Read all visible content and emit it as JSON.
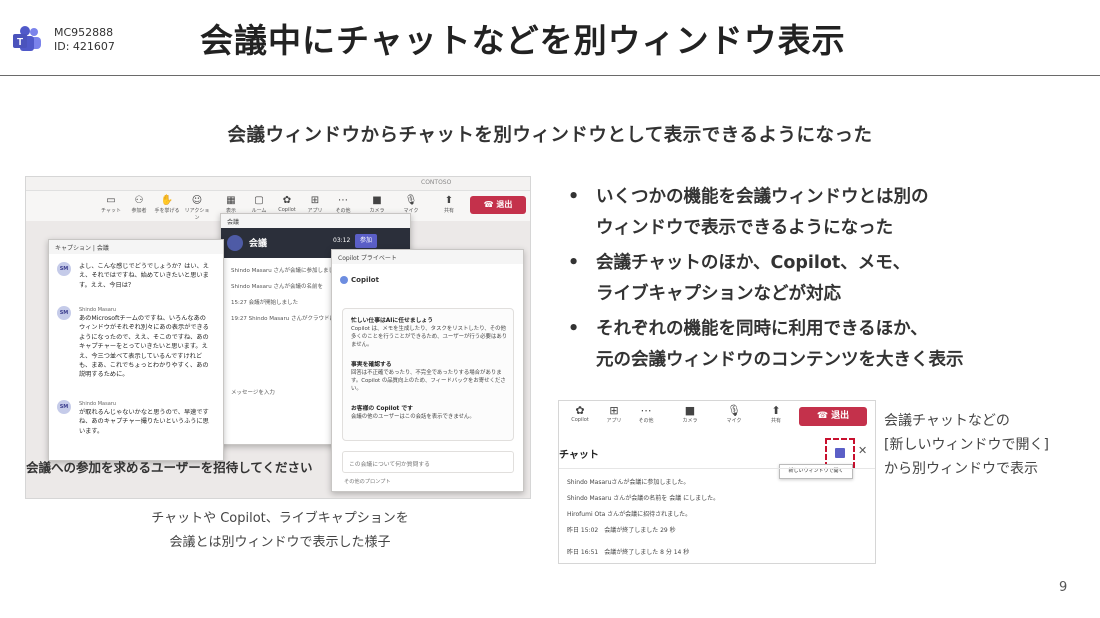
{
  "header": {
    "mc": "MC952888",
    "id": "ID: 421607",
    "title": "会議中にチャットなどを別ウィンドウ表示"
  },
  "subtitle": "会議ウィンドウからチャットを別ウィンドウとして表示できるようになった",
  "left_screenshot": {
    "org": "CONTOSO",
    "toolbar": [
      "チャット",
      "参加者",
      "手を挙げる",
      "リアクション",
      "表示",
      "ルーム",
      "Copilot",
      "アプリ",
      "その他",
      "カメラ",
      "マイク",
      "共有"
    ],
    "leave": "退出",
    "bottom_text": "会議への参加を求めるユーザーを招待してください",
    "meeting": {
      "win_title": "会議",
      "name": "会議",
      "time": "03:12",
      "join": "参加",
      "lines": [
        "Shindo Masaru さんが会議に参加しました。",
        "Shindo Masaru さんが会議の名前を",
        "15:27 会議が開始しました",
        "19:27 Shindo Masaru さんがクラウドに",
        "メッセージを入力"
      ]
    },
    "caption": {
      "win_title": "キャプション | 会議",
      "messages": [
        {
          "avatar": "SM",
          "name": "",
          "text": "よし、こんな感じでどうでしょうか？はい、ええ、それではですね、始めていきたいと思います。ええ、今日は？"
        },
        {
          "avatar": "SM",
          "name": "Shindo Masaru",
          "text": "あのMicrosoftチームのですね、いろんなあのウィンドウがそれぞれ別々にあの表示ができるようになったので、ええ、そこのですね、あのキャプチャーをとっていきたいと思います。ええ、今三つ並べて表示しているんですけれども、まあ、これでちょっとわかりやすく、あの説明するために。"
        },
        {
          "avatar": "SM",
          "name": "Shindo Masaru",
          "text": "が取れるんじゃないかなと思うので、早速ですね、あのキャプチャー撮りたいというふうに思います。"
        }
      ]
    },
    "copilot": {
      "win_title": "Copilot プライベート",
      "head": "Copilot",
      "items": [
        {
          "title": "忙しい仕事はAIに任せましょう",
          "text": "Copilot は、メモを生成したり、タスクをリストしたり、その他多くのことを行うことができるため、ユーザーが行う必要はありません。"
        },
        {
          "title": "事実を確認する",
          "text": "回答は不正確であったり、不完全であったりする場合があります。Copilot の品質向上のため、フィードバックをお寄せください。"
        },
        {
          "title": "お客様の Copilot です",
          "text": "会議の他のユーザーはこの会話を表示できません。"
        }
      ],
      "input": "この会議について何か質問する",
      "footer": "その他のプロンプト"
    }
  },
  "bullets": [
    "いくつかの機能を会議ウィンドウとは別のウィンドウで表示できるようになった",
    "会議チャットのほか、Copilot、メモ、ライブキャプションなどが対応",
    "それぞれの機能を同時に利用できるほか、元の会議ウィンドウのコンテンツを大きく表示"
  ],
  "bullet_lines": [
    [
      "いくつかの機能を会議ウィンドウとは別の",
      "ウィンドウで表示できるようになった"
    ],
    [
      "会議チャットのほか、Copilot、メモ、",
      "ライブキャプションなどが対応"
    ],
    [
      "それぞれの機能を同時に利用できるほか、",
      "元の会議ウィンドウのコンテンツを大きく表示"
    ]
  ],
  "caption_left": [
    "チャットや Copilot、ライブキャプションを",
    "会議とは別ウィンドウで表示した様子"
  ],
  "right_screenshot": {
    "toolbar": [
      "Copilot",
      "アプリ",
      "その他",
      "カメラ",
      "マイク",
      "共有"
    ],
    "leave": "退出",
    "chat_label": "チャット",
    "tooltip": "新しいウィンドウで開く",
    "lines": [
      "Shindo Masaruさんが会議に参加しました。",
      "Shindo Masaru さんが会議の名前を 会議 にしました。",
      "Hirofumi Ota さんが会議に招待されました。",
      "昨日 15:02　会議が終了しました 29 秒",
      "昨日 16:51　会議が終了しました 8 分 14 秒"
    ]
  },
  "caption_right": [
    "会議チャットなどの",
    "[新しいウィンドウで開く]",
    "から別ウィンドウで表示"
  ],
  "page_number": "9"
}
